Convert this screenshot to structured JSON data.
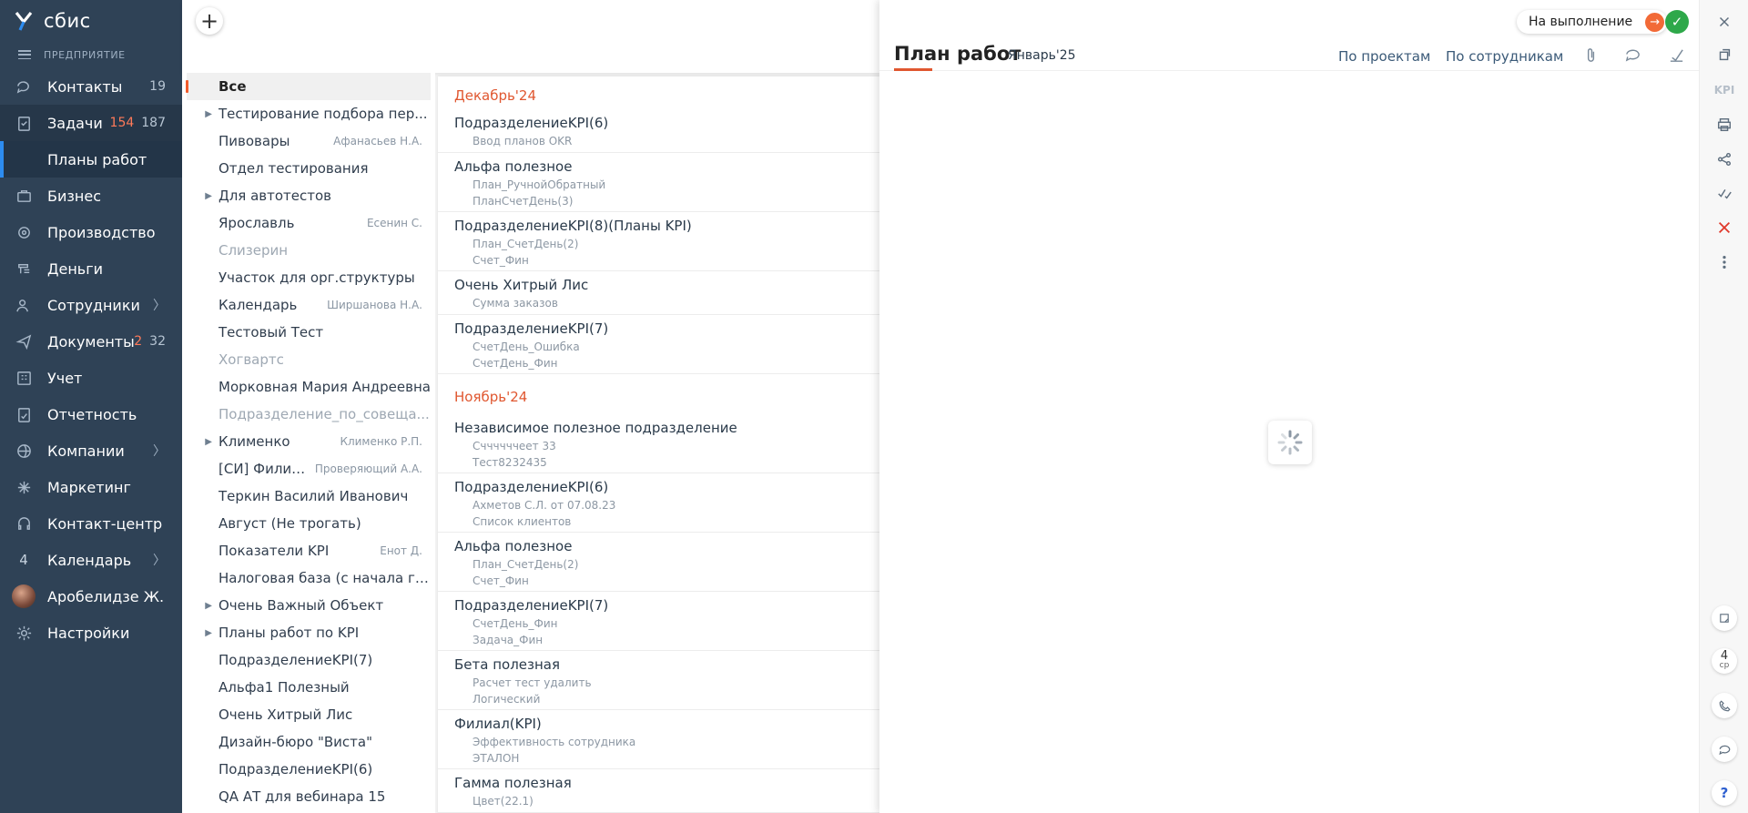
{
  "sidebar": {
    "brand": "сбис",
    "org": "ПРЕДПРИЯТИЕ",
    "items": [
      {
        "label": "Контакты",
        "icon": "chat-icon",
        "count": "19"
      },
      {
        "label": "Задачи",
        "icon": "task-icon",
        "count_red": "154",
        "count": "187",
        "active": true
      },
      {
        "label": "Бизнес",
        "icon": "business-icon"
      },
      {
        "label": "Производство",
        "icon": "production-icon"
      },
      {
        "label": "Деньги",
        "icon": "money-icon"
      },
      {
        "label": "Сотрудники",
        "icon": "employees-icon",
        "chevron": true
      },
      {
        "label": "Документы",
        "icon": "documents-icon",
        "count_red": "2",
        "count": "32"
      },
      {
        "label": "Учет",
        "icon": "accounting-icon"
      },
      {
        "label": "Отчетность",
        "icon": "reports-icon"
      },
      {
        "label": "Компании",
        "icon": "companies-icon",
        "chevron": true
      },
      {
        "label": "Маркетинг",
        "icon": "marketing-icon"
      },
      {
        "label": "Контакт-центр",
        "icon": "headset-icon"
      },
      {
        "label": "Календарь",
        "icon": "calendar-icon",
        "chevron": true,
        "badge": "4"
      },
      {
        "label": "Аробелидзе Ж.",
        "icon": "avatar"
      },
      {
        "label": "Настройки",
        "icon": "settings-icon"
      }
    ],
    "sub_item": "Планы работ"
  },
  "list": [
    {
      "name": "Все",
      "selected": true
    },
    {
      "name": "Тестирование подбора пер...",
      "expand": true
    },
    {
      "name": "Пивовары",
      "owner": "Афанасьев Н.А."
    },
    {
      "name": "Отдел тестирования"
    },
    {
      "name": "Для автотестов",
      "expand": true
    },
    {
      "name": "Ярославль",
      "owner": "Есенин С."
    },
    {
      "name": "Слизерин",
      "muted": true
    },
    {
      "name": "Участок для орг.структуры"
    },
    {
      "name": "Календарь",
      "owner": "Ширшанова Н.А."
    },
    {
      "name": "Тестовый Тест"
    },
    {
      "name": "Хогвартс",
      "muted": true
    },
    {
      "name": "Морковная Мария Андреевна"
    },
    {
      "name": "Подразделение_по_совеща...",
      "muted": true
    },
    {
      "name": "Клименко",
      "owner": "Клименко Р.П.",
      "expand": true
    },
    {
      "name": "[СИ] Филиал",
      "owner": "Проверяющий А.А."
    },
    {
      "name": "Теркин Василий Иванович"
    },
    {
      "name": "Август (Не трогать)"
    },
    {
      "name": "Показатели KPI",
      "owner": "Енот Д."
    },
    {
      "name": "Налоговая база (с начала го..."
    },
    {
      "name": "Очень Важный Объект",
      "expand": true
    },
    {
      "name": "Планы работ по KPI",
      "expand": true
    },
    {
      "name": "ПодразделениеKPI(7)"
    },
    {
      "name": "Альфа1 Полезный"
    },
    {
      "name": "Очень Хитрый Лис"
    },
    {
      "name": "Дизайн-бюро \"Виста\""
    },
    {
      "name": "ПодразделениеKPI(6)"
    },
    {
      "name": "QA АТ для вебинара 15"
    }
  ],
  "plans": {
    "period_dec": "Декабрь'24",
    "period_nov": "Ноябрь'24",
    "dec": [
      {
        "title": "ПодразделениеKPI(6)",
        "subs": [
          "Ввод планов OKR"
        ]
      },
      {
        "title": "Альфа полезное",
        "subs": [
          "План_РучнойОбратный",
          "ПланСчетДень(3)"
        ]
      },
      {
        "title": "ПодразделениеKPI(8)(Планы KPI)",
        "subs": [
          "План_СчетДень(2)",
          "Счет_Фин"
        ]
      },
      {
        "title": "Очень Хитрый Лис",
        "subs": [
          "Сумма заказов"
        ]
      },
      {
        "title": "ПодразделениеKPI(7)",
        "subs": [
          "СчетДень_Ошибка",
          "СчетДень_Фин"
        ]
      }
    ],
    "nov": [
      {
        "title": "Независимое полезное подразделение",
        "subs": [
          "Сччччччеет 33",
          "Тест8232435"
        ]
      },
      {
        "title": "ПодразделениеKPI(6)",
        "subs": [
          "Ахметов С.Л. от 07.08.23",
          "Список клиентов"
        ]
      },
      {
        "title": "Альфа полезное",
        "subs": [
          "План_СчетДень(2)",
          "Счет_Фин"
        ]
      },
      {
        "title": "ПодразделениеKPI(7)",
        "subs": [
          "СчетДень_Фин",
          "Задача_Фин"
        ]
      },
      {
        "title": "Бета полезная",
        "subs": [
          "Расчет тест удалить",
          "Логический"
        ]
      },
      {
        "title": "Филиал(KPI)",
        "subs": [
          "Эффективность сотрудника",
          "ЭТАЛОН"
        ]
      },
      {
        "title": "Гамма полезная",
        "subs": [
          "Цвет(22.1)"
        ]
      }
    ]
  },
  "doc": {
    "title": "План работ",
    "period": "Январь'25",
    "link_projects": "По проектам",
    "link_employees": "По сотрудникам",
    "status": "На выполнение"
  },
  "toolbar": {
    "kpi": "KPI",
    "day_num": "4",
    "day_name": "ср",
    "help": "?"
  },
  "colors": {
    "sidebar": "#2f4256",
    "accent": "#e05730",
    "ok": "#2ea84a"
  }
}
